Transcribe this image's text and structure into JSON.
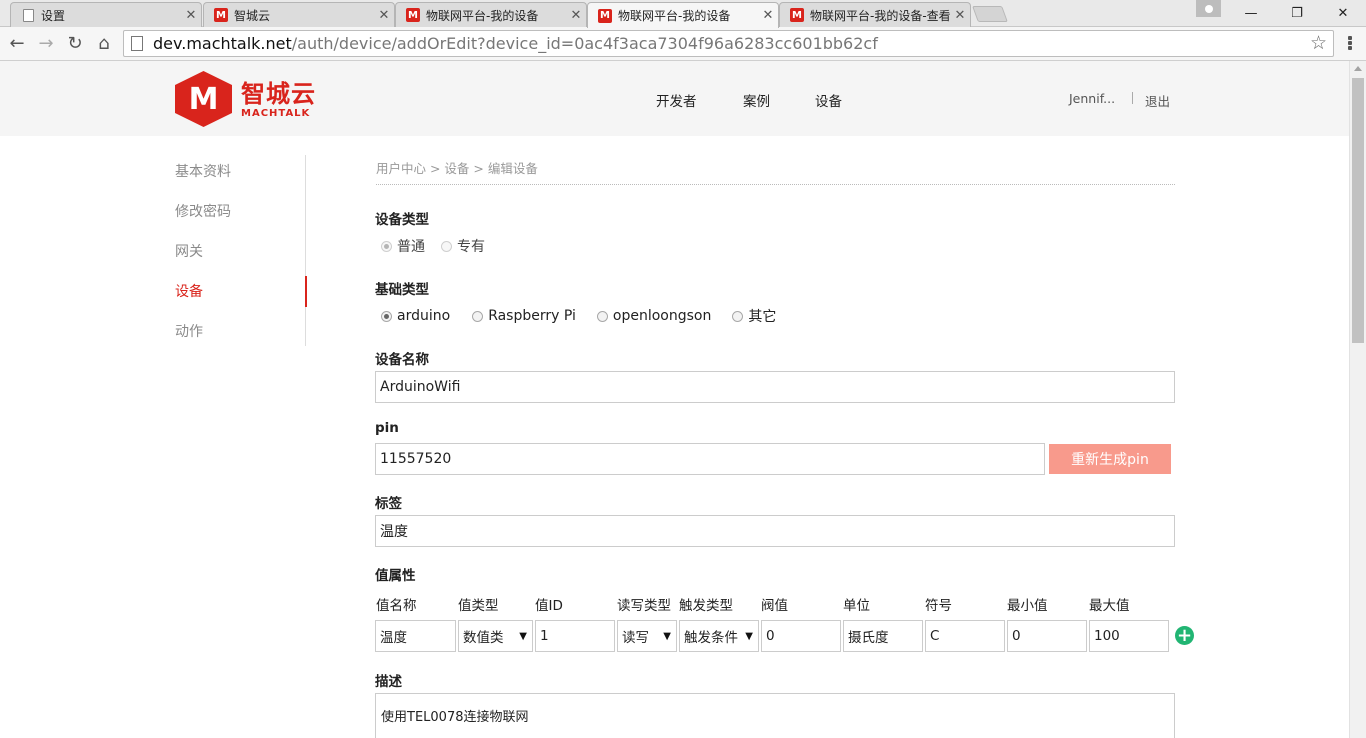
{
  "browser": {
    "tabs": [
      {
        "title": "设置",
        "icon": "page-icon"
      },
      {
        "title": "智城云",
        "icon": "machtalk-favicon"
      },
      {
        "title": "物联网平台-我的设备",
        "icon": "machtalk-favicon"
      },
      {
        "title": "物联网平台-我的设备",
        "icon": "machtalk-favicon",
        "active": true
      },
      {
        "title": "物联网平台-我的设备-查看",
        "icon": "machtalk-favicon"
      }
    ],
    "favicon_letter": "M",
    "url_host": "dev.machtalk.net",
    "url_path": "/auth/device/addOrEdit?device_id=0ac4f3aca7304f96a6283cc601bb62cf"
  },
  "header": {
    "logo_letter": "M",
    "logo_cn": "智城云",
    "logo_en": "MACHTALK",
    "nav": [
      "开发者",
      "案例",
      "设备"
    ],
    "user": "Jennif...",
    "logout": "退出"
  },
  "sidebar": {
    "items": [
      {
        "label": "基本资料"
      },
      {
        "label": "修改密码"
      },
      {
        "label": "网关"
      },
      {
        "label": "设备",
        "active": true
      },
      {
        "label": "动作"
      }
    ]
  },
  "breadcrumb": "用户中心 > 设备 > 编辑设备",
  "form": {
    "device_type": {
      "label": "设备类型",
      "options": [
        "普通",
        "专有"
      ],
      "selected": "普通"
    },
    "base_type": {
      "label": "基础类型",
      "options": [
        "arduino",
        "Raspberry Pi",
        "openloongson",
        "其它"
      ],
      "selected": "arduino"
    },
    "device_name": {
      "label": "设备名称",
      "value": "ArduinoWifi"
    },
    "pin": {
      "label": "pin",
      "value": "11557520",
      "regen_button": "重新生成pin"
    },
    "tag": {
      "label": "标签",
      "value": "温度"
    },
    "value_attrs": {
      "label": "值属性",
      "columns": [
        "值名称",
        "值类型",
        "值ID",
        "读写类型",
        "触发类型",
        "阀值",
        "单位",
        "符号",
        "最小值",
        "最大值"
      ],
      "row": {
        "name": "温度",
        "type": "数值类",
        "id": "1",
        "rw": "读写",
        "trigger": "触发条件",
        "threshold": "0",
        "unit": "摄氏度",
        "symbol": "C",
        "min": "0",
        "max": "100"
      }
    },
    "description": {
      "label": "描述",
      "value": "使用TEL0078连接物联网"
    }
  },
  "colors": {
    "brand": "#d9241c",
    "button": "#f89a8c",
    "add": "#21b573"
  }
}
